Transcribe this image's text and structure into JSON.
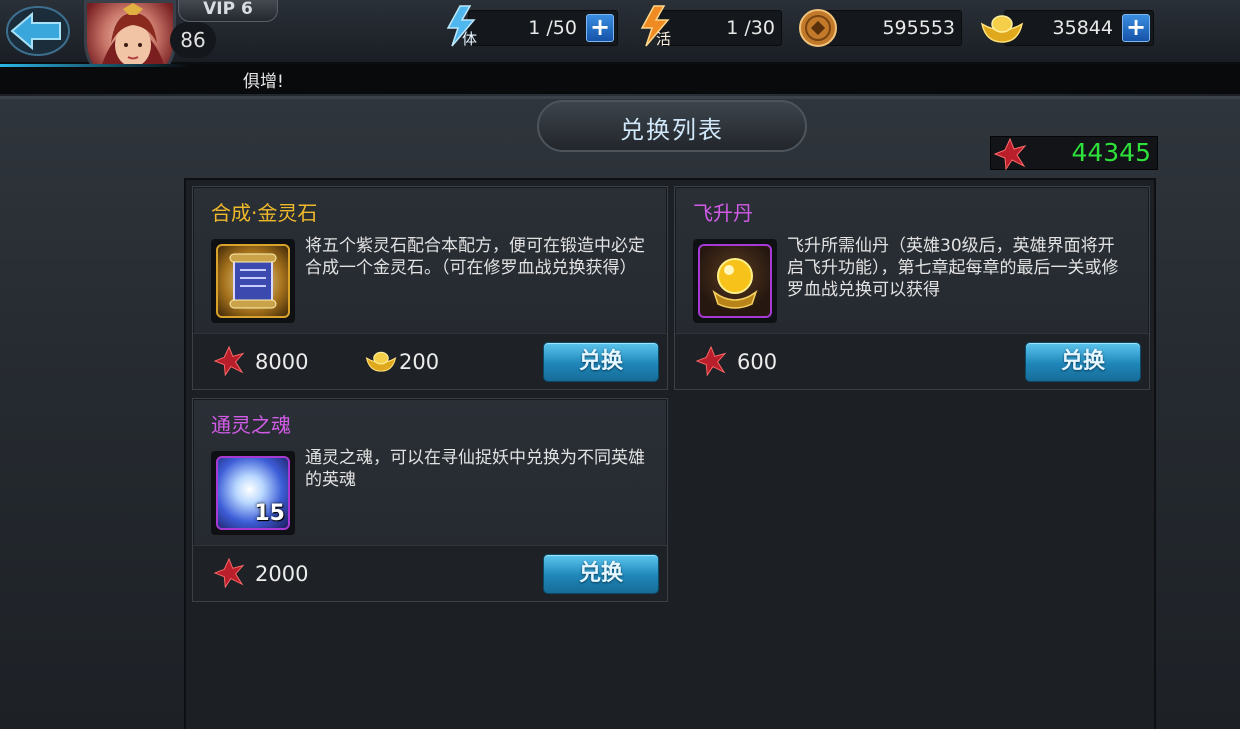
{
  "header": {
    "vip": "VIP 6",
    "level": "86",
    "stamina": "1 /50",
    "vitality": "1 /30",
    "coins": "595553",
    "gold": "35844",
    "plus": "+",
    "news": "俱增!"
  },
  "page": {
    "title": "兑换列表",
    "currency_amount": "44345"
  },
  "items": [
    {
      "name": "合成·金灵石",
      "name_color": "#f0b92a",
      "description": "将五个紫灵石配合本配方，便可在锻造中必定合成一个金灵石。（可在修罗血战兑换获得）",
      "price_blood": "8000",
      "price_gold": "200",
      "button": "兑换"
    },
    {
      "name": "飞升丹",
      "name_color": "#d25ce8",
      "description": "飞升所需仙丹（英雄30级后，英雄界面将开启飞升功能），第七章起每章的最后一关或修罗血战兑换可以获得",
      "price_blood": "600",
      "button": "兑换"
    },
    {
      "name": "通灵之魂",
      "name_color": "#d25ce8",
      "description": "通灵之魂，可以在寻仙捉妖中兑换为不同英雄的英魂",
      "stack": "15",
      "price_blood": "2000",
      "button": "兑换"
    }
  ],
  "icons": {
    "back": "back-arrow-icon",
    "stamina": "lightning-icon",
    "vitality": "fire-lightning-icon",
    "coin": "copper-coin-icon",
    "gold": "gold-ingot-icon",
    "blood": "red-crystal-icon"
  }
}
